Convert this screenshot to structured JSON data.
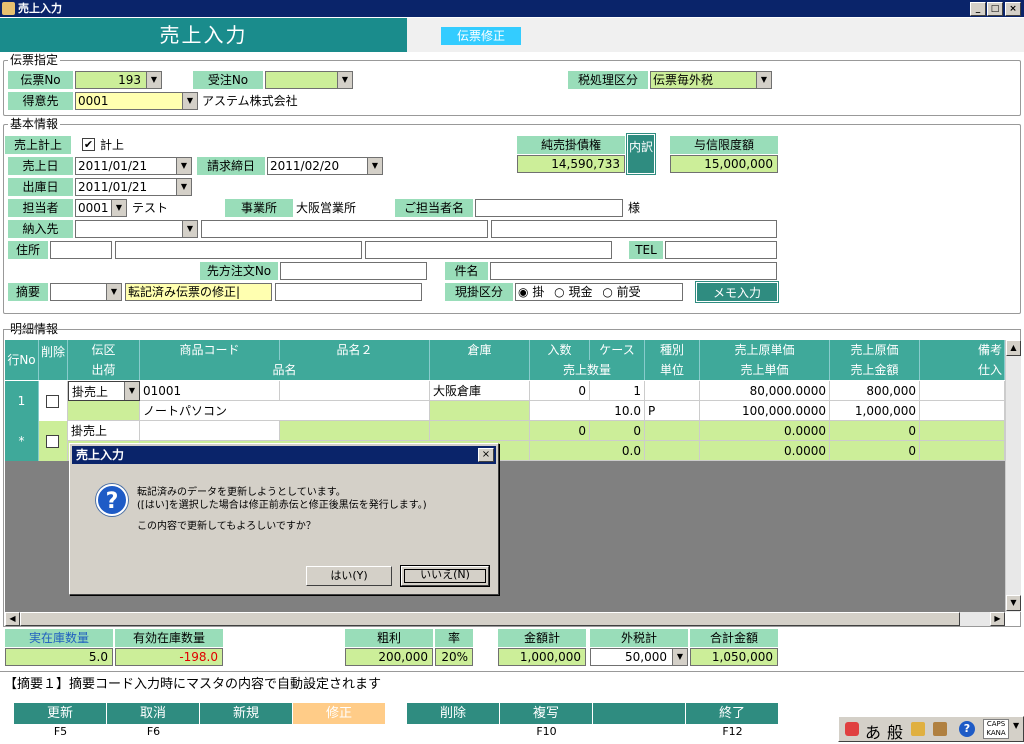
{
  "window": {
    "title": "売上入力",
    "min": "_",
    "max": "□",
    "close": "×"
  },
  "header": {
    "title": "売上入力",
    "mode": "伝票修正"
  },
  "denpyo": {
    "section": "伝票指定",
    "no_label": "伝票No",
    "no_value": "193",
    "juchu_label": "受注No",
    "juchu_value": "",
    "tax_label": "税処理区分",
    "tax_value": "伝票毎外税",
    "customer_label": "得意先",
    "customer_code": "0001",
    "customer_name": "アステム株式会社"
  },
  "kihon": {
    "section": "基本情報",
    "uriage_keijo_label": "売上計上",
    "keijo_check": "✔",
    "keijo_text": "計上",
    "uriage_date_label": "売上日",
    "uriage_date": "2011/01/21",
    "seikyu_label": "請求締日",
    "seikyu_date": "2011/02/20",
    "shukko_label": "出庫日",
    "shukko_date": "2011/01/21",
    "tanto_label": "担当者",
    "tanto_code": "0001",
    "tanto_name": "テスト",
    "office_label": "事業所",
    "office_value": "大阪営業所",
    "gotanto_label": "ご担当者名",
    "sama": "様",
    "nonyu_label": "納入先",
    "address_label": "住所",
    "tel_label": "TEL",
    "sakikata_label": "先方注文No",
    "kenmei_label": "件名",
    "tekiyo_label": "摘要",
    "tekiyo_text": "転記済み伝票の修正|",
    "genkake_label": "現掛区分",
    "opt_kake": "掛",
    "opt_genkin": "現金",
    "opt_maeuke": "前受",
    "memo_button": "メモ入力",
    "credit_label": "純売掛債権",
    "credit_value": "14,590,733",
    "uchiwake": "内訳",
    "limit_label": "与信限度額",
    "limit_value": "15,000,000"
  },
  "meisai": {
    "section": "明細情報",
    "h_gyo": "行No",
    "h_sakujo": "削除",
    "h_denku": "伝区",
    "h_shukka": "出荷",
    "h_code": "商品コード",
    "h_name2": "品名２",
    "h_name": "品名",
    "h_soko": "倉庫",
    "h_irisu": "入数",
    "h_case": "ケース",
    "h_qty": "売上数量",
    "h_shubetsu": "種別",
    "h_unit": "単位",
    "h_genka_tanka": "売上原単価",
    "h_tanka": "売上単価",
    "h_genka": "売上原価",
    "h_kingaku": "売上金額",
    "h_biko": "備考",
    "h_shiire": "仕入",
    "row1": {
      "no": "1",
      "denku": "掛売上",
      "code": "01001",
      "soko": "大阪倉庫",
      "irisu": "0",
      "case": "1",
      "genka_tanka": "80,000.0000",
      "genka": "800,000",
      "name": "ノートパソコン",
      "qty": "10.0",
      "unit": "P",
      "tanka": "100,000.0000",
      "kingaku": "1,000,000"
    },
    "row2": {
      "no": "*",
      "denku": "掛売上",
      "irisu": "0",
      "case": "0",
      "genka_tanka": "0.0000",
      "genka": "0",
      "qty": "0.0",
      "tanka": "0.0000",
      "kingaku": "0"
    }
  },
  "dialog": {
    "title": "売上入力",
    "line1": "転記済みのデータを更新しようとしています。",
    "line2": "([はい]を選択した場合は修正前赤伝と修正後黒伝を発行します。)",
    "line3": "この内容で更新してもよろしいですか？",
    "yes": "はい(Y)",
    "no": "いいえ(N)"
  },
  "totals": {
    "zaiko_label": "実在庫数量",
    "zaiko_value": "5.0",
    "yuko_label": "有効在庫数量",
    "yuko_value": "-198.0",
    "arari_label": "粗利",
    "arari_value": "200,000",
    "ritsu_label": "率",
    "ritsu_value": "20%",
    "kingaku_label": "金額計",
    "kingaku_value": "1,000,000",
    "zei_label": "外税計",
    "zei_value": "50,000",
    "gokei_label": "合計金額",
    "gokei_value": "1,050,000"
  },
  "status": "【摘要１】摘要コード入力時にマスタの内容で自動設定されます",
  "fkeys": [
    {
      "label": "更新",
      "key": "F5"
    },
    {
      "label": "取消",
      "key": "F6"
    },
    {
      "label": "新規",
      "key": ""
    },
    {
      "label": "修正",
      "key": ""
    },
    {
      "label": "削除",
      "key": ""
    },
    {
      "label": "複写",
      "key": "F10"
    },
    {
      "label": "",
      "key": ""
    },
    {
      "label": "終了",
      "key": "F12"
    }
  ],
  "ime": {
    "a": "あ",
    "han": "般",
    "caps": "CAPS",
    "kana": "KANA"
  },
  "colors": {
    "header": "#1a8c8c",
    "label": "#99ddb9",
    "input_yellow": "#ffffb0",
    "input_green": "#ccee99",
    "mode_badge": "#33ccff",
    "selected_key": "#ffcc88"
  }
}
